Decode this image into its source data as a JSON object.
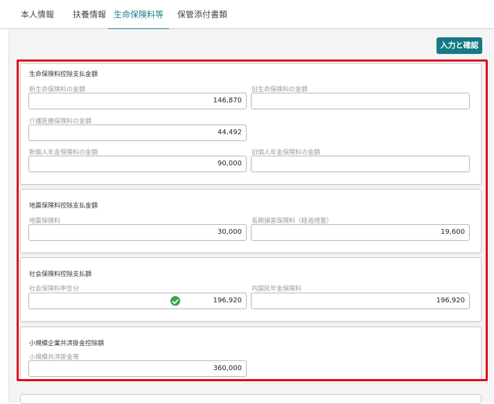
{
  "tabs": [
    {
      "label": "本人情報",
      "active": false
    },
    {
      "label": "扶養情報",
      "active": false
    },
    {
      "label": "生命保険料等",
      "active": true
    },
    {
      "label": "保管添付書類",
      "active": false
    }
  ],
  "toolbar": {
    "confirm_label": "入力と確認"
  },
  "life_insurance": {
    "title": "生命保険料控除支払金額",
    "new_life_label": "新生命保険料の金額",
    "new_life_value": "146,870",
    "old_life_label": "旧生命保険料の金額",
    "old_life_value": "",
    "medical_label": "介護医療保険料の金額",
    "medical_value": "44,492",
    "new_pension_label": "新個人年金保険料の金額",
    "new_pension_value": "90,000",
    "old_pension_label": "旧個人年金保険料の金額",
    "old_pension_value": ""
  },
  "earthquake": {
    "title": "地震保険料控除支払金額",
    "earthquake_label": "地震保険料",
    "earthquake_value": "30,000",
    "longterm_label": "長期損害保険料（経過措置）",
    "longterm_value": "19,600"
  },
  "social": {
    "title": "社会保険料控除支払額",
    "declared_label": "社会保険料申告分",
    "declared_value": "196,920",
    "pension_label": "内国民年金保険料",
    "pension_value": "196,920"
  },
  "small_business": {
    "title": "小規模企業共済掛金控除額",
    "mutual_label": "小規模共済掛金等",
    "mutual_value": "360,000"
  },
  "colors": {
    "accent": "#167a86",
    "highlight": "#e0000f",
    "check": "#3fa34d"
  },
  "icons": {
    "check": "check-circle-icon"
  }
}
